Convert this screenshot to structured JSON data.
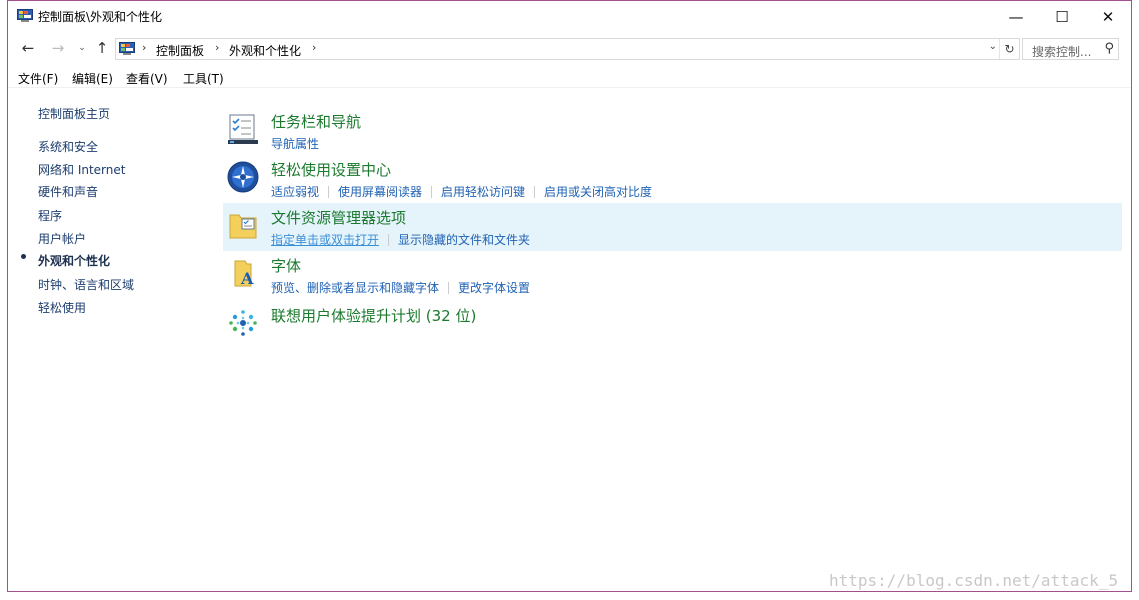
{
  "window": {
    "title": "控制面板\\外观和个性化",
    "controls": {
      "minimize": "—",
      "maximize": "☐",
      "close": "✕"
    }
  },
  "address_bar": {
    "back": "←",
    "forward": "→",
    "recent": "⌄",
    "up": "↑",
    "breadcrumbs": [
      "控制面板",
      "外观和个性化"
    ],
    "separator": "›",
    "dropdown": "⌄",
    "refresh": "↻"
  },
  "search": {
    "placeholder": "搜索控制...",
    "icon": "⚲"
  },
  "menu": {
    "items": [
      "文件(F)",
      "编辑(E)",
      "查看(V)",
      "工具(T)"
    ]
  },
  "left_nav": {
    "items": [
      {
        "label": "控制面板主页"
      },
      {
        "label": "系统和安全"
      },
      {
        "label": "网络和 Internet"
      },
      {
        "label": "硬件和声音"
      },
      {
        "label": "程序"
      },
      {
        "label": "用户帐户"
      },
      {
        "label": "外观和个性化",
        "active": true
      },
      {
        "label": "时钟、语言和区域"
      },
      {
        "label": "轻松使用"
      }
    ]
  },
  "categories": [
    {
      "title": "任务栏和导航",
      "icon": "taskbar-icon",
      "links": [
        "导航属性"
      ]
    },
    {
      "title": "轻松使用设置中心",
      "icon": "ease-of-access-icon",
      "links": [
        "适应弱视",
        "使用屏幕阅读器",
        "启用轻松访问键",
        "启用或关闭高对比度"
      ]
    },
    {
      "title": "文件资源管理器选项",
      "icon": "folder-options-icon",
      "links": [
        "指定单击或双击打开",
        "显示隐藏的文件和文件夹"
      ],
      "highlighted": true
    },
    {
      "title": "字体",
      "icon": "fonts-folder-icon",
      "links": [
        "预览、删除或者显示和隐藏字体",
        "更改字体设置"
      ]
    },
    {
      "title": "联想用户体验提升计划 (32 位)",
      "icon": "lenovo-program-icon",
      "links": []
    }
  ],
  "watermark": "https://blog.csdn.net/attack_5",
  "colors": {
    "category_title": "#1b7a2e",
    "link": "#1f62b3",
    "highlight_bg": "#e5f3fb",
    "window_border": "#a24f8f"
  }
}
